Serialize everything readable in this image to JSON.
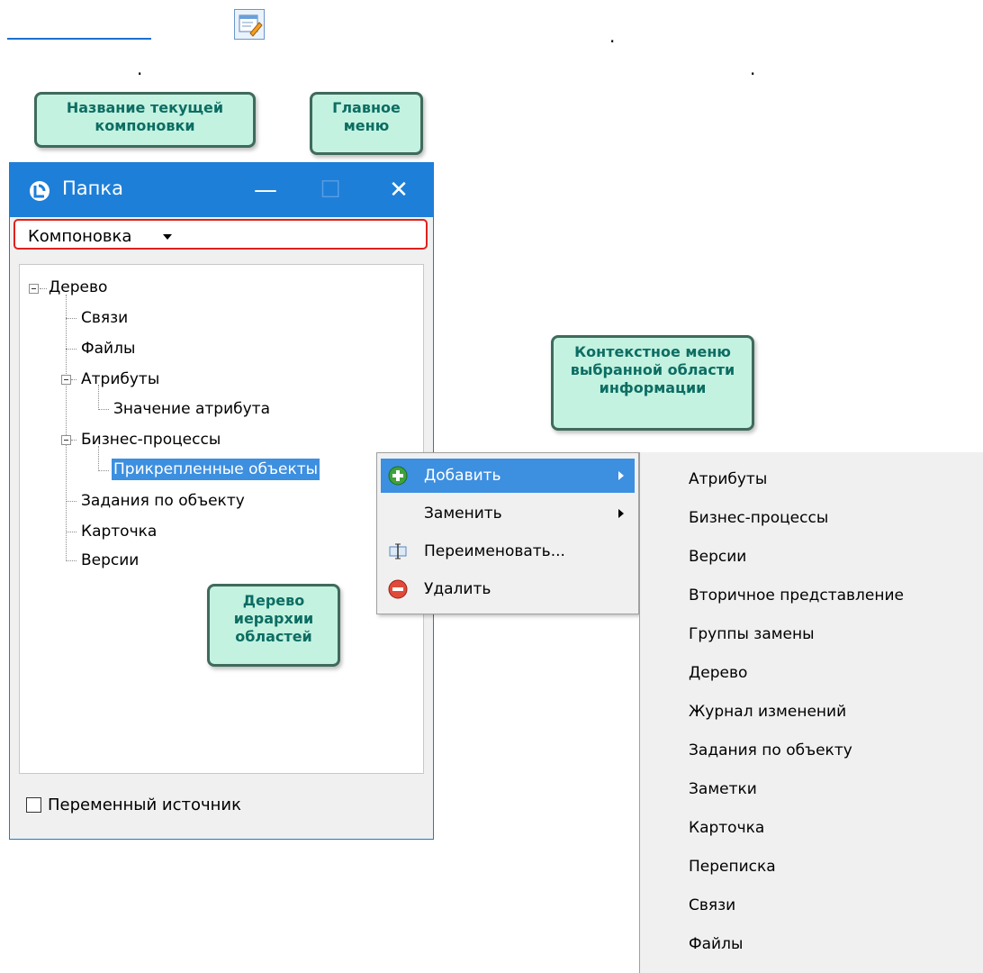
{
  "doc": {
    "dots": [
      ".",
      ".",
      "."
    ]
  },
  "window": {
    "title": "Папка",
    "controls": {
      "minimize": "—",
      "maximize": "☐",
      "close": "✕"
    },
    "layout_menu_label": "Компоновка",
    "tree": {
      "root": "Дерево",
      "items": [
        "Связи",
        "Файлы",
        "Атрибуты",
        "Значение атрибута",
        "Бизнес-процессы",
        "Прикрепленные объекты",
        "Задания по объекту",
        "Карточка",
        "Версии"
      ]
    },
    "variable_source_label": "Переменный источник"
  },
  "context_menu": {
    "items": [
      {
        "label": "Добавить",
        "icon": "add-icon",
        "submenu": true
      },
      {
        "label": "Заменить",
        "icon": "",
        "submenu": true
      },
      {
        "label": "Переименовать...",
        "icon": "rename-icon",
        "submenu": false
      },
      {
        "label": "Удалить",
        "icon": "delete-icon",
        "submenu": false
      }
    ]
  },
  "submenu": {
    "items": [
      "Атрибуты",
      "Бизнес-процессы",
      "Версии",
      "Вторичное представление",
      "Группы замены",
      "Дерево",
      "Журнал изменений",
      "Задания по объекту",
      "Заметки",
      "Карточка",
      "Переписка",
      "Связи",
      "Файлы"
    ]
  },
  "callouts": {
    "layout_name": "Название текущей компоновки",
    "main_menu": "Главное меню",
    "context_menu": "Контекстное меню выбранной области информации",
    "tree": "Дерево иерархии областей"
  },
  "colors": {
    "titlebar": "#1e7fd8",
    "selection": "#3d8fe0",
    "callout_fill": "#c3f2e1",
    "callout_text": "#0d6d62",
    "highlight_border": "#e0201c"
  }
}
